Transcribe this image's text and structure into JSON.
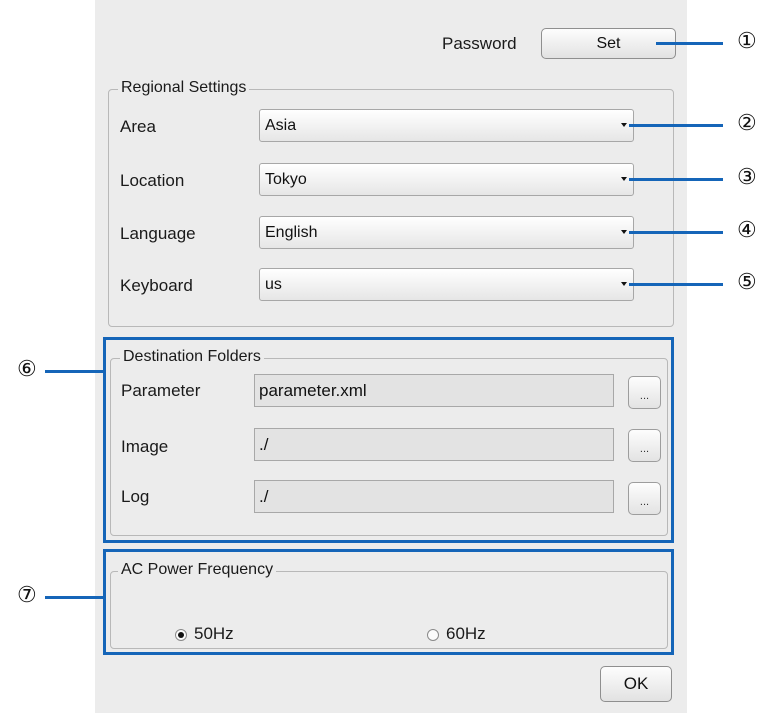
{
  "password": {
    "label": "Password",
    "set_button": "Set"
  },
  "regional": {
    "legend": "Regional Settings",
    "area": {
      "label": "Area",
      "value": "Asia"
    },
    "location": {
      "label": "Location",
      "value": "Tokyo"
    },
    "language": {
      "label": "Language",
      "value": "English"
    },
    "keyboard": {
      "label": "Keyboard",
      "value": "us"
    }
  },
  "destination": {
    "legend": "Destination Folders",
    "parameter": {
      "label": "Parameter",
      "value": "parameter.xml"
    },
    "image": {
      "label": "Image",
      "value": "./"
    },
    "log": {
      "label": "Log",
      "value": "./"
    },
    "browse_label": "..."
  },
  "power": {
    "legend": "AC Power Frequency",
    "option_50": "50Hz",
    "option_60": "60Hz",
    "selected": "50Hz"
  },
  "ok_button": "OK",
  "callouts": [
    "①",
    "②",
    "③",
    "④",
    "⑤",
    "⑥",
    "⑦"
  ],
  "colors": {
    "callout_blue": "#1565b8",
    "panel_bg": "#ececec"
  }
}
